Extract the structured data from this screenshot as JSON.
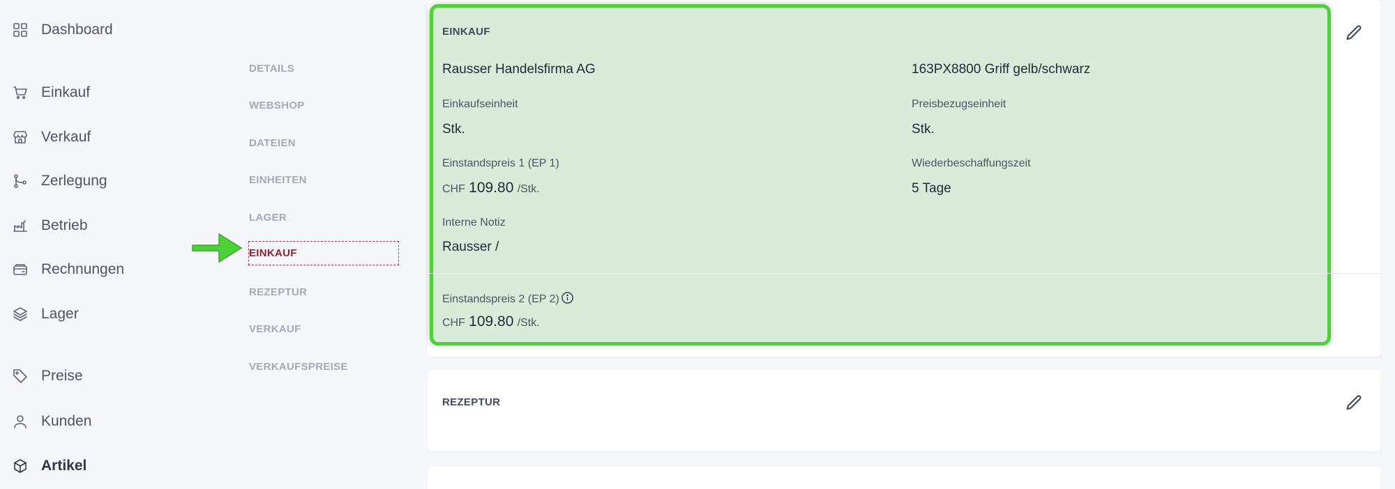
{
  "sidebar": {
    "items": [
      {
        "label": "Dashboard",
        "icon": "dashboard-grid-icon"
      },
      {
        "label": "Einkauf",
        "icon": "cart-icon"
      },
      {
        "label": "Verkauf",
        "icon": "store-icon"
      },
      {
        "label": "Zerlegung",
        "icon": "branch-icon"
      },
      {
        "label": "Betrieb",
        "icon": "factory-icon"
      },
      {
        "label": "Rechnungen",
        "icon": "wallet-icon"
      },
      {
        "label": "Lager",
        "icon": "layers-icon"
      },
      {
        "label": "Preise",
        "icon": "tag-icon"
      },
      {
        "label": "Kunden",
        "icon": "user-icon"
      },
      {
        "label": "Artikel",
        "icon": "box-icon",
        "active": true
      }
    ]
  },
  "subnav": {
    "items": [
      "DETAILS",
      "WEBSHOP",
      "DATEIEN",
      "EINHEITEN",
      "LAGER",
      "EINKAUF",
      "REZEPTUR",
      "VERKAUF",
      "VERKAUFSPREISE"
    ],
    "active": "EINKAUF"
  },
  "einkauf": {
    "title": "EINKAUF",
    "supplier": "Rausser Handelsfirma AG",
    "article_ref": "163PX8800 Griff gelb/schwarz",
    "einkaufseinheit_label": "Einkaufseinheit",
    "einkaufseinheit_value": "Stk.",
    "preisbezugseinheit_label": "Preisbezugseinheit",
    "preisbezugseinheit_value": "Stk.",
    "ep1_label": "Einstandspreis 1 (EP 1)",
    "ep1_currency": "CHF",
    "ep1_value": "109.80",
    "ep1_unit": "/Stk.",
    "wbz_label": "Wiederbeschaffungszeit",
    "wbz_value": "5 Tage",
    "notiz_label": "Interne Notiz",
    "notiz_value": "Rausser /",
    "ep2_label": "Einstandspreis 2 (EP 2)",
    "ep2_currency": "CHF",
    "ep2_value": "109.80",
    "ep2_unit": "/Stk."
  },
  "rezeptur": {
    "title": "REZEPTUR"
  },
  "colors": {
    "highlight_border": "#4cd137",
    "arrow": "#4cd137",
    "active_subnav": "#8b2232"
  }
}
